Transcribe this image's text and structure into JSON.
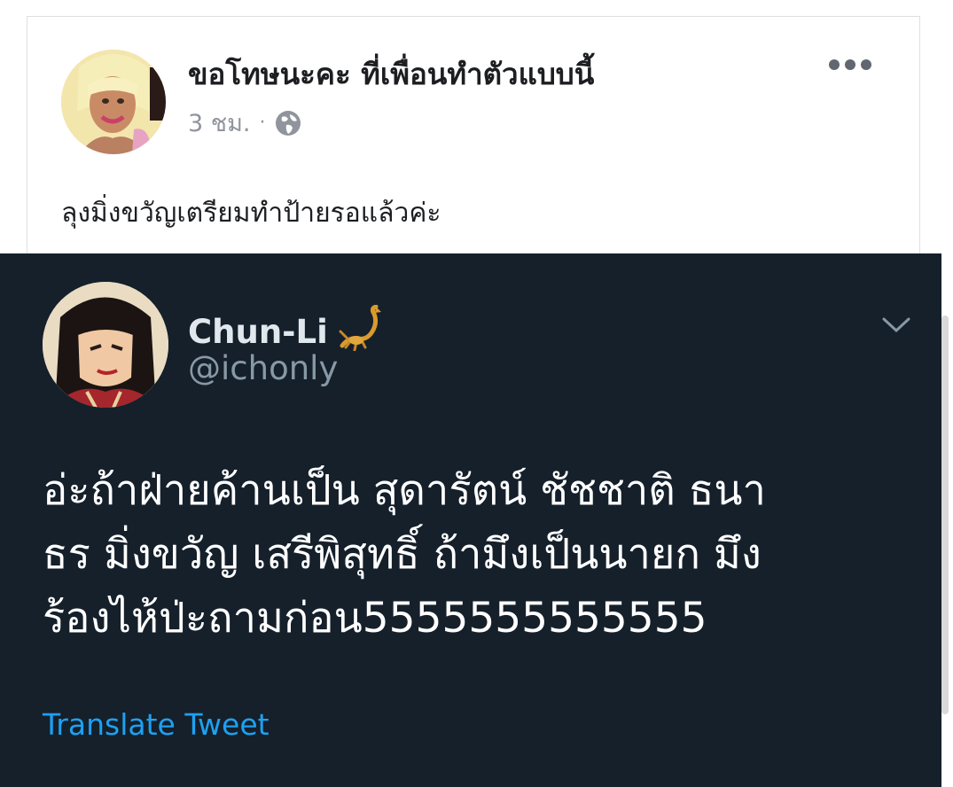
{
  "facebook_post": {
    "author_name": "ขอโทษนะคะ ที่เพื่อนทำตัวแบบนี้",
    "timestamp": "3 ชม.",
    "separator": "·",
    "text": "ลุงมิ่งขวัญเตรียมทำป้ายรอแล้วค่ะ",
    "icons": {
      "more": "more-horizontal-icon",
      "audience": "globe-icon"
    }
  },
  "tweet": {
    "display_name": "Chun-Li",
    "name_emoji": "scorpion-emoji",
    "handle": "@ichonly",
    "body_lines": [
      "อ่ะถ้าฝ่ายค้านเป็น สุดารัตน์ ชัชชาติ ธนา",
      "ธร มิ่งขวัญ เสรีพิสุทธิ์ ถ้ามึงเป็นนายก มึง",
      "ร้องไห้ป่ะถามก่อน5555555555555"
    ],
    "translate_label": "Translate Tweet",
    "icons": {
      "caret": "chevron-down-icon"
    }
  },
  "colors": {
    "tweet_bg": "#15202b",
    "tweet_text": "#ffffff",
    "tweet_secondary": "#8899a6",
    "link": "#1da1f2",
    "fb_name": "#1c1e21",
    "fb_meta": "#90949c"
  }
}
